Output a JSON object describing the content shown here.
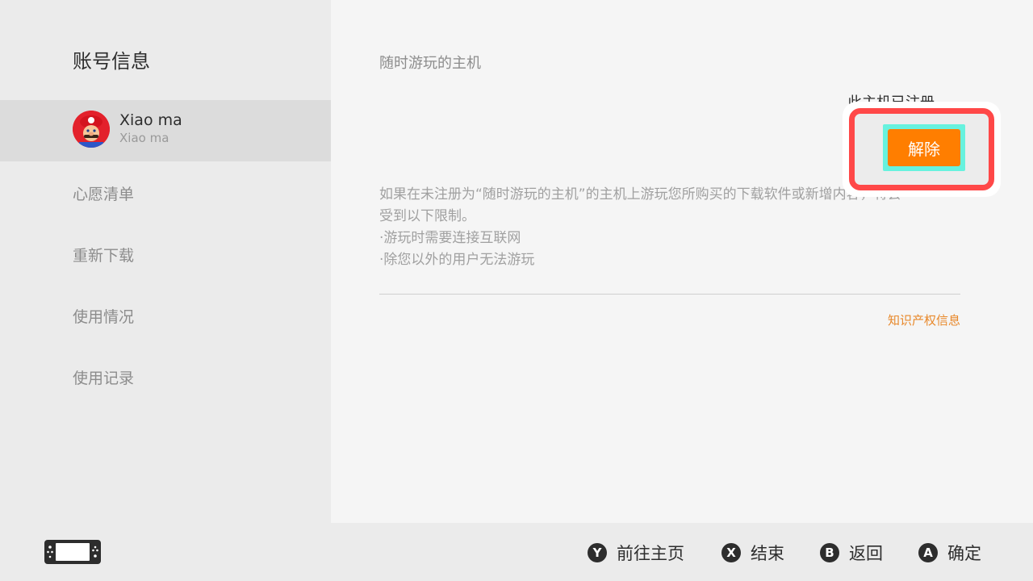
{
  "sidebar": {
    "title": "账号信息",
    "user": {
      "name": "Xiao ma",
      "subname": "Xiao ma"
    },
    "items": [
      {
        "label": "心愿清单"
      },
      {
        "label": "重新下载"
      },
      {
        "label": "使用情况"
      },
      {
        "label": "使用记录"
      }
    ]
  },
  "main": {
    "section_title": "随时游玩的主机",
    "registered_status": "此主机已注册",
    "release_button": "解除",
    "description": [
      "如果在未注册为“随时游玩的主机”的主机上游玩您所购买的下载软件或新增内容，将会",
      "受到以下限制。",
      "·游玩时需要连接互联网",
      "·除您以外的用户无法游玩"
    ],
    "ip_link": "知识产权信息"
  },
  "footer": {
    "buttons": [
      {
        "key": "Y",
        "label": "前往主页"
      },
      {
        "key": "X",
        "label": "结束"
      },
      {
        "key": "B",
        "label": "返回"
      },
      {
        "key": "A",
        "label": "确定"
      }
    ]
  },
  "colors": {
    "accent": "#ff7e00",
    "highlight_ring": "#ff4848",
    "focus_glow": "#67f2de",
    "link": "#e8882a"
  }
}
